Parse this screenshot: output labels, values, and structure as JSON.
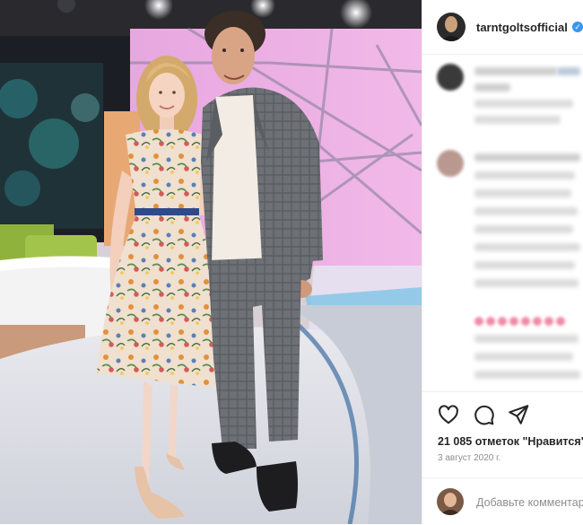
{
  "post": {
    "username": "tarntgoltsofficial",
    "verified_glyph": "✓",
    "likes": "21 085 отметок \"Нравится\"",
    "date": "3 август 2020 г."
  },
  "comment_box": {
    "placeholder": "Добавьте комментарий..."
  },
  "icons": {
    "like": "heart-icon",
    "comment": "comment-icon",
    "share": "share-icon",
    "verified": "verified-badge-icon"
  },
  "colors": {
    "verified_blue": "#3897f0",
    "text": "#262626",
    "muted": "#8e8e8e"
  }
}
